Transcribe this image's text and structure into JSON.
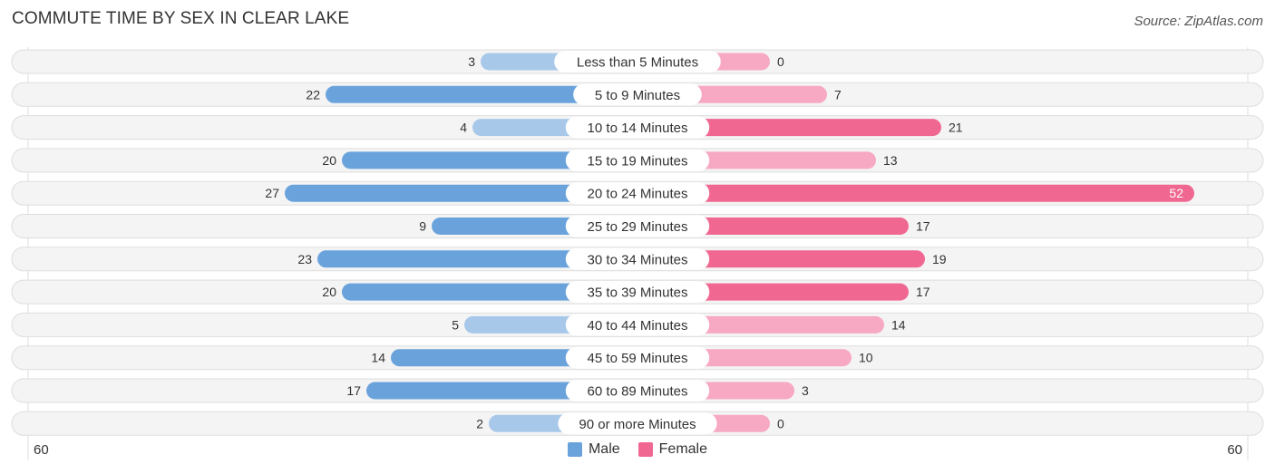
{
  "title": "COMMUTE TIME BY SEX IN CLEAR LAKE",
  "source": "Source: ZipAtlas.com",
  "colors": {
    "male_dark": "#6aa3dc",
    "male_light": "#a8c8ea",
    "female_dark": "#f06892",
    "female_light": "#f7a8c2",
    "row_bg": "#f4f4f4"
  },
  "chart_data": {
    "type": "bar",
    "orientation": "horizontal-diverging",
    "title": "COMMUTE TIME BY SEX IN CLEAR LAKE",
    "categories": [
      "Less than 5 Minutes",
      "5 to 9 Minutes",
      "10 to 14 Minutes",
      "15 to 19 Minutes",
      "20 to 24 Minutes",
      "25 to 29 Minutes",
      "30 to 34 Minutes",
      "35 to 39 Minutes",
      "40 to 44 Minutes",
      "45 to 59 Minutes",
      "60 to 89 Minutes",
      "90 or more Minutes"
    ],
    "series": [
      {
        "name": "Male",
        "values": [
          3,
          22,
          4,
          20,
          27,
          9,
          23,
          20,
          5,
          14,
          17,
          2
        ]
      },
      {
        "name": "Female",
        "values": [
          0,
          7,
          21,
          13,
          52,
          17,
          19,
          17,
          14,
          10,
          3,
          0
        ]
      }
    ],
    "axis_min_label": "60",
    "axis_max_label": "60",
    "xlim": [
      -60,
      60
    ],
    "legend": [
      "Male",
      "Female"
    ],
    "legend_position": "bottom-center"
  }
}
